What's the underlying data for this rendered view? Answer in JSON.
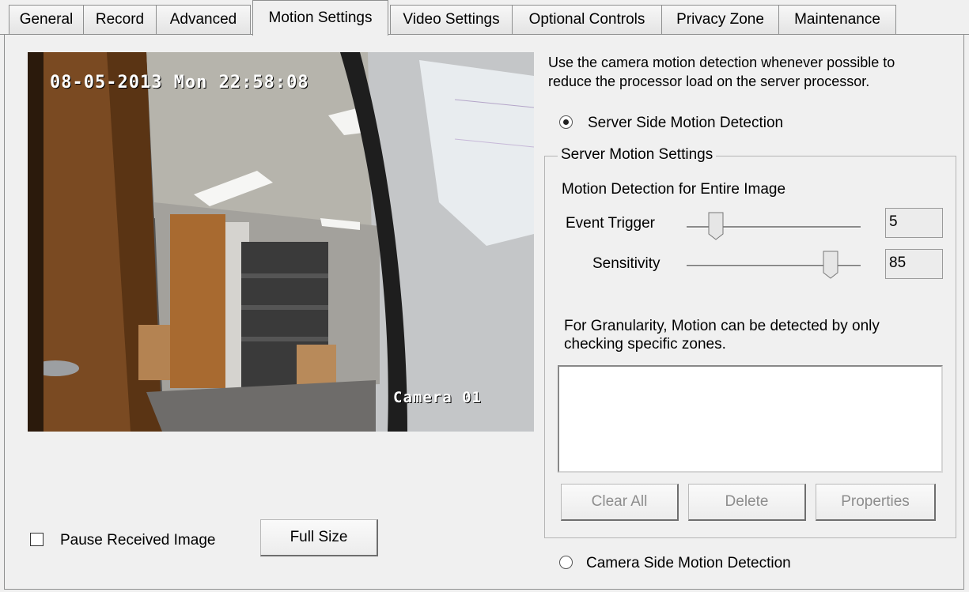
{
  "tabs": [
    {
      "label": "General",
      "active": false
    },
    {
      "label": "Record",
      "active": false
    },
    {
      "label": "Advanced",
      "active": false
    },
    {
      "label": "Motion Settings",
      "active": true
    },
    {
      "label": "Video Settings",
      "active": false
    },
    {
      "label": "Optional Controls",
      "active": false
    },
    {
      "label": "Privacy Zone",
      "active": false
    },
    {
      "label": "Maintenance",
      "active": false
    }
  ],
  "camera": {
    "timestamp": "08-05-2013 Mon 22:58:08",
    "name": "Camera 01"
  },
  "info_text_1": "Use the camera motion detection whenever possible to",
  "info_text_2": "reduce the processor load on the server processor.",
  "server_side_radio": {
    "label": "Server Side Motion Detection",
    "checked": true
  },
  "camera_side_radio": {
    "label": "Camera Side Motion Detection",
    "checked": false
  },
  "server_settings": {
    "title": "Server Motion Settings",
    "subtitle": "Motion Detection for Entire Image",
    "event_trigger": {
      "label": "Event Trigger",
      "value": "5"
    },
    "sensitivity": {
      "label": "Sensitivity",
      "value": "85"
    },
    "granularity_text_1": "For Granularity, Motion can be detected by only",
    "granularity_text_2": "checking specific zones.",
    "buttons": {
      "clear_all": "Clear All",
      "delete": "Delete",
      "properties": "Properties"
    }
  },
  "pause_checkbox": {
    "label": "Pause Received Image",
    "checked": false
  },
  "full_size_button": "Full Size"
}
